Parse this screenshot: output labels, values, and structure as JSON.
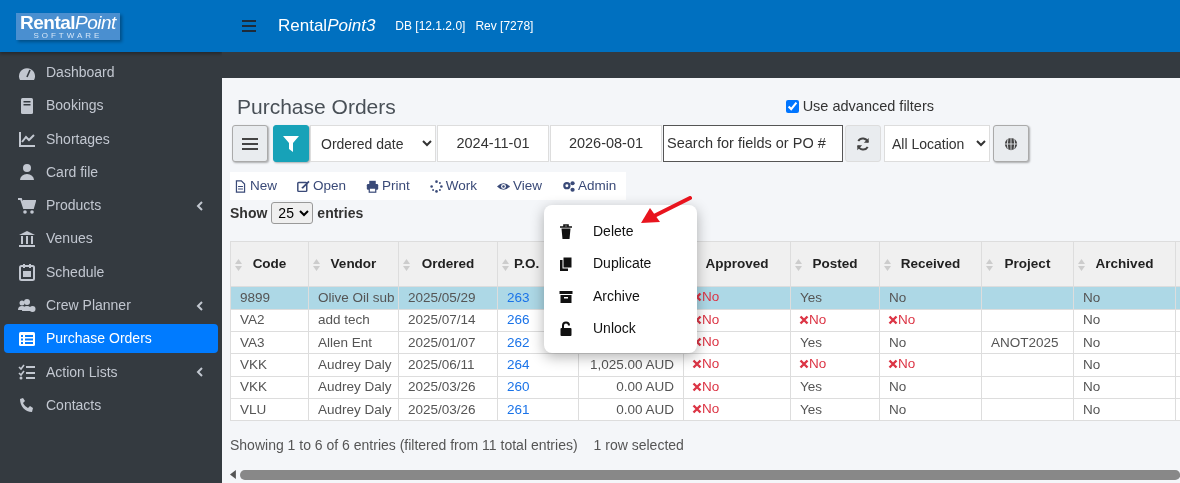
{
  "brand": {
    "logo": "Rental",
    "logo_italic_part": "Point",
    "logo_sub": "SOFTWARE"
  },
  "topbar": {
    "app_name": "Rental",
    "app_name_italic": "Point3",
    "db": "DB [12.1.2.0]",
    "rev": "Rev [7278]"
  },
  "sidebar": {
    "items": [
      {
        "label": "Dashboard",
        "selected": false,
        "has_submenu": false
      },
      {
        "label": "Bookings",
        "selected": false,
        "has_submenu": false
      },
      {
        "label": "Shortages",
        "selected": false,
        "has_submenu": false
      },
      {
        "label": "Card file",
        "selected": false,
        "has_submenu": false
      },
      {
        "label": "Products",
        "selected": false,
        "has_submenu": true
      },
      {
        "label": "Venues",
        "selected": false,
        "has_submenu": false
      },
      {
        "label": "Schedule",
        "selected": false,
        "has_submenu": false
      },
      {
        "label": "Crew Planner",
        "selected": false,
        "has_submenu": true
      },
      {
        "label": "Purchase Orders",
        "selected": true,
        "has_submenu": false
      },
      {
        "label": "Action Lists",
        "selected": false,
        "has_submenu": true
      },
      {
        "label": "Contacts",
        "selected": false,
        "has_submenu": false
      }
    ]
  },
  "page_title": "Purchase Orders",
  "advanced_filters": {
    "label": "Use advanced filters",
    "checked": true
  },
  "filters": {
    "date_field": "Ordered date",
    "date_from": "2024-11-01",
    "date_to": "2026-08-01",
    "search_placeholder": "Search for fields or PO #",
    "location": "All Location"
  },
  "toolbar": [
    "New",
    "Open",
    "Print",
    "Work",
    "View",
    "Admin"
  ],
  "length_menu": {
    "prefix": "Show",
    "value": "25",
    "suffix": "entries"
  },
  "table": {
    "columns": [
      {
        "label": "Code",
        "sort_arrows": true
      },
      {
        "label": "Vendor",
        "sort_arrows": true
      },
      {
        "label": "Ordered",
        "sort_arrows": true
      },
      {
        "label": "P.O.",
        "sort_arrows": true
      },
      {},
      {
        "label": "Approved",
        "sort_arrows": false
      },
      {
        "label": "Posted",
        "sort_arrows": true
      },
      {
        "label": "Received",
        "sort_arrows": true
      },
      {
        "label": "Project",
        "sort_arrows": true
      },
      {
        "label": "Archived",
        "sort_arrows": true
      }
    ],
    "rows": [
      {
        "selected": true,
        "cells": [
          {
            "kind": "text",
            "text": "9899"
          },
          {
            "kind": "text",
            "text": "Olive Oil sub"
          },
          {
            "kind": "text",
            "text": "2025/05/29"
          },
          {
            "kind": "link",
            "text": "263"
          },
          {
            "kind": "text"
          },
          {
            "kind": "no",
            "text": "No"
          },
          {
            "kind": "text",
            "text": "Yes"
          },
          {
            "kind": "text",
            "text": "No"
          },
          {
            "kind": "text"
          },
          {
            "kind": "text",
            "text": "No"
          }
        ]
      },
      {
        "selected": false,
        "cells": [
          {
            "kind": "text",
            "text": "VA2"
          },
          {
            "kind": "text",
            "text": "add tech"
          },
          {
            "kind": "text",
            "text": "2025/07/14"
          },
          {
            "kind": "link",
            "text": "266"
          },
          {
            "kind": "text"
          },
          {
            "kind": "no",
            "text": "No"
          },
          {
            "kind": "no",
            "text": "No"
          },
          {
            "kind": "no",
            "text": "No"
          },
          {
            "kind": "text"
          },
          {
            "kind": "text",
            "text": "No"
          }
        ]
      },
      {
        "selected": false,
        "cells": [
          {
            "kind": "text",
            "text": "VA3"
          },
          {
            "kind": "text",
            "text": "Allen Ent"
          },
          {
            "kind": "text",
            "text": "2025/01/07"
          },
          {
            "kind": "link",
            "text": "262"
          },
          {
            "kind": "text"
          },
          {
            "kind": "no",
            "text": "No"
          },
          {
            "kind": "text",
            "text": "Yes"
          },
          {
            "kind": "text",
            "text": "No"
          },
          {
            "kind": "text",
            "text": "ANOT2025"
          },
          {
            "kind": "text",
            "text": "No"
          }
        ]
      },
      {
        "selected": false,
        "cells": [
          {
            "kind": "text",
            "text": "VKK"
          },
          {
            "kind": "text",
            "text": "Audrey Daly"
          },
          {
            "kind": "text",
            "text": "2025/06/11"
          },
          {
            "kind": "link",
            "text": "264"
          },
          {
            "kind": "amount",
            "text": "1,025.00 AUD"
          },
          {
            "kind": "no",
            "text": "No"
          },
          {
            "kind": "no",
            "text": "No"
          },
          {
            "kind": "no",
            "text": "No"
          },
          {
            "kind": "text"
          },
          {
            "kind": "text",
            "text": "No"
          }
        ]
      },
      {
        "selected": false,
        "cells": [
          {
            "kind": "text",
            "text": "VKK"
          },
          {
            "kind": "text",
            "text": "Audrey Daly"
          },
          {
            "kind": "text",
            "text": "2025/03/26"
          },
          {
            "kind": "link",
            "text": "260"
          },
          {
            "kind": "amount",
            "text": "0.00 AUD"
          },
          {
            "kind": "no",
            "text": "No"
          },
          {
            "kind": "text",
            "text": "Yes"
          },
          {
            "kind": "text",
            "text": "No"
          },
          {
            "kind": "text"
          },
          {
            "kind": "text",
            "text": "No"
          }
        ]
      },
      {
        "selected": false,
        "cells": [
          {
            "kind": "text",
            "text": "VLU"
          },
          {
            "kind": "text",
            "text": "Audrey Daly"
          },
          {
            "kind": "text",
            "text": "2025/03/26"
          },
          {
            "kind": "link",
            "text": "261"
          },
          {
            "kind": "amount",
            "text": "0.00 AUD"
          },
          {
            "kind": "no",
            "text": "No"
          },
          {
            "kind": "text",
            "text": "Yes"
          },
          {
            "kind": "text",
            "text": "No"
          },
          {
            "kind": "text"
          },
          {
            "kind": "text",
            "text": "No"
          }
        ]
      }
    ]
  },
  "table_info": "Showing 1 to 6 of 6 entries (filtered from 11 total entries)",
  "selection_info": "1 row selected",
  "admin_menu": [
    "Delete",
    "Duplicate",
    "Archive",
    "Unlock"
  ]
}
